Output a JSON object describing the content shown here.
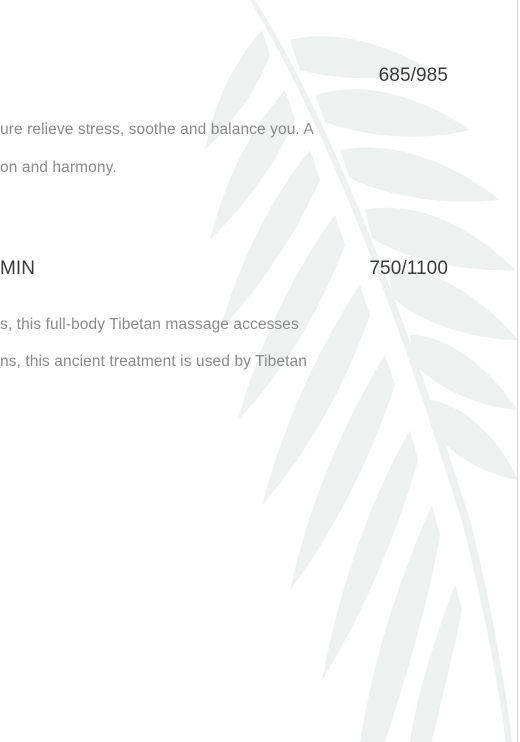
{
  "menu": {
    "items": [
      {
        "title": "",
        "price": "685/985",
        "description_lines": [
          "ure relieve stress,  soothe and balance you. A",
          "on and harmony."
        ]
      },
      {
        "title": "MIN",
        "price": "750/1100",
        "description_lines": [
          "s, this full-body Tibetan massage accesses",
          "ns, this ancient treatment is used by Tibetan"
        ]
      }
    ]
  },
  "decor": {
    "icon": "palm-leaf-icon",
    "leaf_color": "#edf0ee"
  }
}
